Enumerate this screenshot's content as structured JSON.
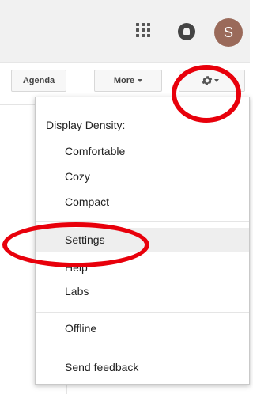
{
  "header": {
    "apps_icon": "apps-grid-icon",
    "notifications_icon": "notifications-icon",
    "avatar_initial": "S",
    "avatar_color": "#9a6a5a"
  },
  "toolbar": {
    "agenda_label": "Agenda",
    "more_label": "More",
    "settings_icon": "gear-icon"
  },
  "menu": {
    "section_header": "Display Density:",
    "density_options": [
      "Comfortable",
      "Cozy",
      "Compact"
    ],
    "items": [
      "Settings",
      "Help",
      "Labs"
    ],
    "offline": "Offline",
    "feedback": "Send feedback"
  },
  "annotations": {
    "color": "#e8000b"
  }
}
